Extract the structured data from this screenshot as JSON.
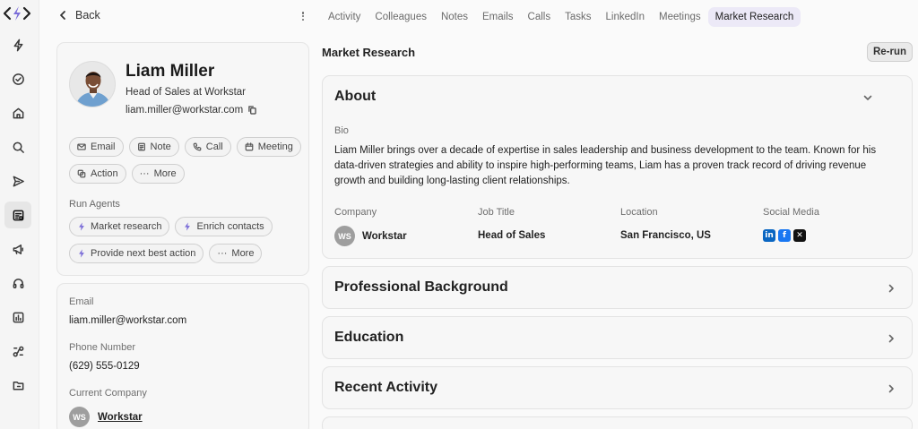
{
  "nav": {
    "back_label": "Back",
    "tabs": [
      {
        "label": "Activity"
      },
      {
        "label": "Colleagues"
      },
      {
        "label": "Notes"
      },
      {
        "label": "Emails"
      },
      {
        "label": "Calls"
      },
      {
        "label": "Tasks"
      },
      {
        "label": "LinkedIn"
      },
      {
        "label": "Meetings"
      },
      {
        "label": "Market Research",
        "active": true
      }
    ]
  },
  "sidebar": {
    "icons": [
      "bolt-icon",
      "check-circle-icon",
      "home-icon",
      "search-icon",
      "send-icon",
      "contacts-icon",
      "megaphone-icon",
      "headset-icon",
      "analytics-icon",
      "integrations-icon",
      "folder-icon"
    ],
    "active": "contacts-icon"
  },
  "profile": {
    "name": "Liam Miller",
    "title": "Head of Sales at Workstar",
    "email": "liam.miller@workstar.com",
    "actions": [
      "Email",
      "Note",
      "Call",
      "Meeting",
      "Action",
      "More"
    ],
    "run_agents_label": "Run Agents",
    "agents": [
      "Market research",
      "Enrich contacts",
      "Provide next best action",
      "More"
    ]
  },
  "details": {
    "email_label": "Email",
    "email_value": "liam.miller@workstar.com",
    "phone_label": "Phone Number",
    "phone_value": "(629) 555-0129",
    "company_label": "Current Company",
    "company_initials": "WS",
    "company_value": "Workstar"
  },
  "research": {
    "title": "Market Research",
    "rerun_label": "Re-run",
    "about": {
      "heading": "About",
      "bio_label": "Bio",
      "bio": "Liam Miller brings over a decade of expertise in sales leadership and business development to the team. Known for his data-driven strategies and ability to inspire high-performing teams, Liam has a proven track record of driving revenue growth and building long-lasting client relationships.",
      "company_label": "Company",
      "company_initials": "WS",
      "company_value": "Workstar",
      "job_label": "Job Title",
      "job_value": "Head of Sales",
      "location_label": "Location",
      "location_value": "San Francisco, US",
      "social_label": "Social Media",
      "social_icons": [
        "linkedin-icon",
        "facebook-icon",
        "x-icon"
      ]
    },
    "sections": [
      "Professional Background",
      "Education",
      "Recent Activity"
    ]
  },
  "colors": {
    "active_tab_bg": "#ece9f7",
    "agent_bolt": "#7a6cd8",
    "linkedin": "#0a66c2",
    "facebook": "#1877f2",
    "x": "#111111"
  }
}
